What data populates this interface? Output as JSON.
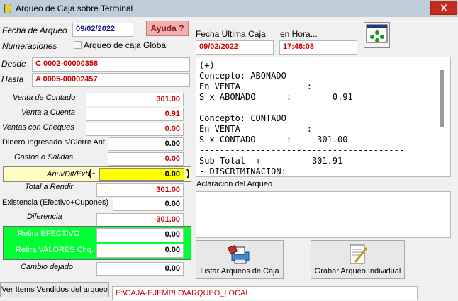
{
  "window": {
    "title": "Arqueo de Caja sobre Terminal",
    "close": "X"
  },
  "fecha_arqueo": {
    "label": "Fecha de Arqueo",
    "value": "09/02/2022"
  },
  "ayuda": {
    "label": "Ayuda ?"
  },
  "numeraciones": {
    "label": "Numeraciones"
  },
  "global": {
    "label": "Arqueo de caja Global",
    "checked": false
  },
  "desde": {
    "label": "Desde",
    "value": "C 0002-00000358"
  },
  "hasta": {
    "label": "Hasta",
    "value": "A 0005-00002457"
  },
  "fecha_ultima": {
    "label": "Fecha Última Caja",
    "value": "09/02/2022"
  },
  "hora": {
    "label": "en Hora...",
    "value": "17:48:08"
  },
  "rows": {
    "venta_contado": {
      "label": "Venta de Contado",
      "value": "301.00"
    },
    "venta_cuenta": {
      "label": "Venta a Cuenta",
      "value": "0.91"
    },
    "ventas_cheques": {
      "label": "Ventas con Cheques",
      "value": "0.00"
    },
    "dinero_ingresado": {
      "label": "Dinero Ingresado s/Cierre Ant.",
      "value": "0.00"
    },
    "gastos": {
      "label": "Gastos o Salidas",
      "value": "0.00"
    },
    "anul": {
      "label": "Anul/Dif/Extr.",
      "open": "(-",
      "value": "0.00",
      "close": ")"
    },
    "total_rendir": {
      "label": "Total a Rendir",
      "value": "301.00"
    },
    "existencia": {
      "label": "Existencia (Efectivo+Cupones)",
      "value": "0.00"
    },
    "diferencia": {
      "label": "Diferencia",
      "value": "-301.00"
    },
    "retira_efectivo": {
      "label": "Retira EFECTIVO",
      "value": "0.00"
    },
    "retira_valores": {
      "label": "Retira VALORES Chq.",
      "value": "0.00"
    },
    "cambio": {
      "label": "Cambio dejado",
      "value": "0.00"
    }
  },
  "report": {
    "text": "(+)\nConcepto: ABONADO\nEn VENTA             :\nS x ABONADO      :        0.91\n----------------------------------------\nConcepto: CONTADO\nEn VENTA             :\nS x CONTADO      :     301.00\n----------------------------------------\nSub Total  +          301.91\n- DISCRIMINACION:"
  },
  "aclaracion": {
    "label": "Aclaracion del Arqueo",
    "value": ""
  },
  "buttons": {
    "listar": "Listar Arqueos de Caja",
    "grabar": "Grabar Arqueo Individual",
    "ver_items": "Ver Items Vendidos del arqueo"
  },
  "path": {
    "value": "E:\\CAJA-EJEMPLO\\ARQUEO_LOCAL"
  },
  "colors": {
    "accent_red": "#d00000",
    "green": "#00ff33",
    "yellow": "#ffff00"
  },
  "icons": {
    "monitor": "monitor-dots-icon",
    "listar": "printer-list-icon",
    "grabar": "document-edit-icon",
    "app": "app-icon"
  }
}
